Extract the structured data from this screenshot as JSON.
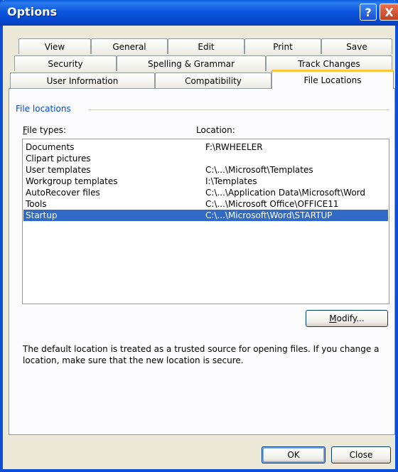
{
  "window": {
    "title": "Options",
    "help_glyph": "?",
    "close_glyph": "X"
  },
  "tabs": {
    "row1": [
      "View",
      "General",
      "Edit",
      "Print",
      "Save"
    ],
    "row2": [
      "Security",
      "Spelling & Grammar",
      "Track Changes"
    ],
    "row3": [
      "User Information",
      "Compatibility",
      "File Locations"
    ],
    "active": "File Locations"
  },
  "panel": {
    "group_title": "File locations",
    "file_types_label_first": "F",
    "file_types_label_rest": "ile types:",
    "location_label": "Location:",
    "rows": [
      {
        "type": "Documents",
        "location": "F:\\RWHEELER"
      },
      {
        "type": "Clipart pictures",
        "location": ""
      },
      {
        "type": "User templates",
        "location": "C:\\...\\Microsoft\\Templates"
      },
      {
        "type": "Workgroup templates",
        "location": "I:\\Templates"
      },
      {
        "type": "AutoRecover files",
        "location": "C:\\...\\Application Data\\Microsoft\\Word"
      },
      {
        "type": "Tools",
        "location": "C:\\...\\Microsoft Office\\OFFICE11"
      },
      {
        "type": "Startup",
        "location": "C:\\...\\Microsoft\\Word\\STARTUP"
      }
    ],
    "selected_row": "Startup",
    "modify_first": "M",
    "modify_rest": "odify...",
    "note": "The default location is treated as a trusted source for opening files. If you change a location, make sure that the new location is secure."
  },
  "footer": {
    "ok_label": "OK",
    "close_label": "Close"
  },
  "colors": {
    "title_bar": "#0A4DD6",
    "selection": "#316AC5",
    "group_title": "#0046D5",
    "active_tab_accent": "#FFC83C"
  }
}
